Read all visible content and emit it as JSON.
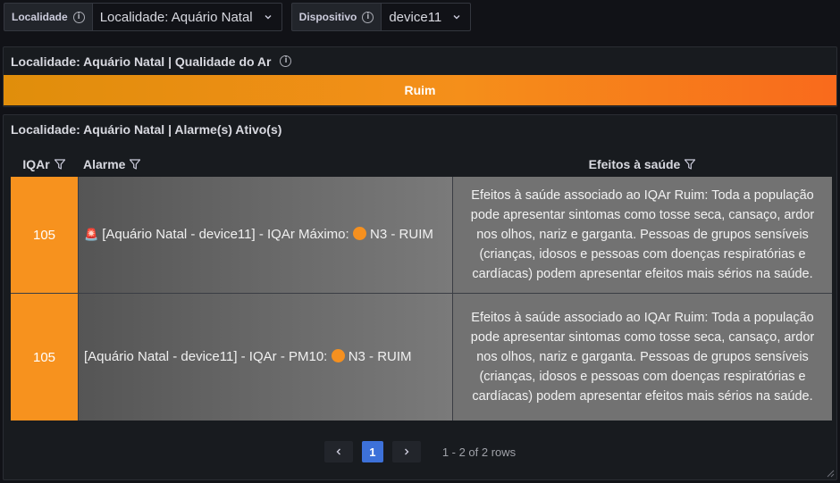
{
  "variables": [
    {
      "label": "Localidade",
      "value": "Localidade: Aquário Natal"
    },
    {
      "label": "Dispositivo",
      "value": "device11"
    }
  ],
  "stat_panel": {
    "title": "Localidade: Aquário Natal | Qualidade do Ar",
    "value": "Ruim",
    "color": "#f58f1a"
  },
  "table_panel": {
    "title": "Localidade: Aquário Natal | Alarme(s) Ativo(s)",
    "columns": [
      "IQAr",
      "Alarme",
      "Efeitos à saúde"
    ],
    "rows": [
      {
        "iqar": "105",
        "alarm_prefix_icon": "siren-icon",
        "alarm_part1": "[Aquário Natal - device11] - IQAr Máximo:",
        "alarm_part2": "N3 - RUIM",
        "effects": "Efeitos à saúde associado ao IQAr Ruim: Toda a população pode apresentar sintomas como tosse seca, cansaço, ardor nos olhos, nariz e garganta. Pessoas de grupos sensíveis (crianças, idosos e pessoas com doenças respiratórias e cardíacas) podem apresentar efeitos mais sérios na saúde."
      },
      {
        "iqar": "105",
        "alarm_part1": "[Aquário Natal - device11] - IQAr - PM10:",
        "alarm_part2": "N3 - RUIM",
        "effects": "Efeitos à saúde associado ao IQAr Ruim: Toda a população pode apresentar sintomas como tosse seca, cansaço, ardor nos olhos, nariz e garganta. Pessoas de grupos sensíveis (crianças, idosos e pessoas com doenças respiratórias e cardíacas) podem apresentar efeitos mais sérios na saúde."
      }
    ],
    "iqar_color": "#f7921e",
    "pagination": {
      "prev": "‹",
      "current_page": "1",
      "next": "›",
      "summary": "1 - 2 of 2 rows"
    }
  }
}
